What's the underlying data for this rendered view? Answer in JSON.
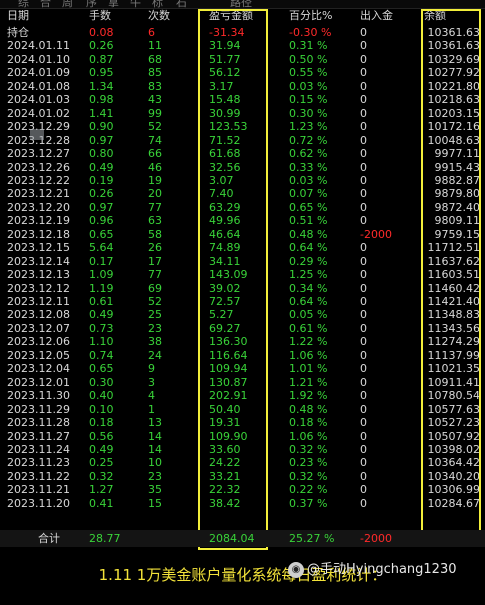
{
  "top_menu": [
    "综",
    "合",
    "周",
    "序",
    "拿",
    "牛",
    "标",
    "石",
    "路径"
  ],
  "headers": {
    "date": "日期",
    "qty": "手数",
    "count": "次数",
    "pnl": "盈亏金额",
    "pct": "百分比%",
    "io": "出入金",
    "balance": "余额"
  },
  "rows": [
    {
      "date": "持仓",
      "qty": "0.08",
      "count": "6",
      "pnl": "-31.34",
      "pct": "-0.30 %",
      "io": "0",
      "balance": "10361.63",
      "tone": "red"
    },
    {
      "date": "2024.01.11",
      "qty": "0.26",
      "count": "11",
      "pnl": "31.94",
      "pct": "0.31 %",
      "io": "0",
      "balance": "10361.63",
      "tone": "green"
    },
    {
      "date": "2024.01.10",
      "qty": "0.87",
      "count": "68",
      "pnl": "51.77",
      "pct": "0.50 %",
      "io": "0",
      "balance": "10329.69",
      "tone": "green"
    },
    {
      "date": "2024.01.09",
      "qty": "0.95",
      "count": "85",
      "pnl": "56.12",
      "pct": "0.55 %",
      "io": "0",
      "balance": "10277.92",
      "tone": "green"
    },
    {
      "date": "2024.01.08",
      "qty": "1.34",
      "count": "83",
      "pnl": "3.17",
      "pct": "0.03 %",
      "io": "0",
      "balance": "10221.80",
      "tone": "green"
    },
    {
      "date": "2024.01.03",
      "qty": "0.98",
      "count": "43",
      "pnl": "15.48",
      "pct": "0.15 %",
      "io": "0",
      "balance": "10218.63",
      "tone": "green"
    },
    {
      "date": "2024.01.02",
      "qty": "1.41",
      "count": "99",
      "pnl": "30.99",
      "pct": "0.30 %",
      "io": "0",
      "balance": "10203.15",
      "tone": "green"
    },
    {
      "date": "2023.12.29",
      "qty": "0.90",
      "count": "52",
      "pnl": "123.53",
      "pct": "1.23 %",
      "io": "0",
      "balance": "10172.16",
      "tone": "green"
    },
    {
      "date": "2023.12.28",
      "qty": "0.97",
      "count": "74",
      "pnl": "71.52",
      "pct": "0.72 %",
      "io": "0",
      "balance": "10048.63",
      "tone": "green"
    },
    {
      "date": "2023.12.27",
      "qty": "0.80",
      "count": "66",
      "pnl": "61.68",
      "pct": "0.62 %",
      "io": "0",
      "balance": "9977.11",
      "tone": "green"
    },
    {
      "date": "2023.12.26",
      "qty": "0.49",
      "count": "46",
      "pnl": "32.56",
      "pct": "0.33 %",
      "io": "0",
      "balance": "9915.43",
      "tone": "green"
    },
    {
      "date": "2023.12.22",
      "qty": "0.19",
      "count": "19",
      "pnl": "3.07",
      "pct": "0.03 %",
      "io": "0",
      "balance": "9882.87",
      "tone": "green"
    },
    {
      "date": "2023.12.21",
      "qty": "0.26",
      "count": "20",
      "pnl": "7.40",
      "pct": "0.07 %",
      "io": "0",
      "balance": "9879.80",
      "tone": "green"
    },
    {
      "date": "2023.12.20",
      "qty": "0.97",
      "count": "77",
      "pnl": "63.29",
      "pct": "0.65 %",
      "io": "0",
      "balance": "9872.40",
      "tone": "green"
    },
    {
      "date": "2023.12.19",
      "qty": "0.96",
      "count": "63",
      "pnl": "49.96",
      "pct": "0.51 %",
      "io": "0",
      "balance": "9809.11",
      "tone": "green"
    },
    {
      "date": "2023.12.18",
      "qty": "0.65",
      "count": "58",
      "pnl": "46.64",
      "pct": "0.48 %",
      "io": "-2000",
      "balance": "9759.15",
      "tone": "green",
      "io_tone": "red"
    },
    {
      "date": "2023.12.15",
      "qty": "5.64",
      "count": "26",
      "pnl": "74.89",
      "pct": "0.64 %",
      "io": "0",
      "balance": "11712.51",
      "tone": "green"
    },
    {
      "date": "2023.12.14",
      "qty": "0.17",
      "count": "17",
      "pnl": "34.11",
      "pct": "0.29 %",
      "io": "0",
      "balance": "11637.62",
      "tone": "green"
    },
    {
      "date": "2023.12.13",
      "qty": "1.09",
      "count": "77",
      "pnl": "143.09",
      "pct": "1.25 %",
      "io": "0",
      "balance": "11603.51",
      "tone": "green"
    },
    {
      "date": "2023.12.12",
      "qty": "1.19",
      "count": "69",
      "pnl": "39.02",
      "pct": "0.34 %",
      "io": "0",
      "balance": "11460.42",
      "tone": "green"
    },
    {
      "date": "2023.12.11",
      "qty": "0.61",
      "count": "52",
      "pnl": "72.57",
      "pct": "0.64 %",
      "io": "0",
      "balance": "11421.40",
      "tone": "green"
    },
    {
      "date": "2023.12.08",
      "qty": "0.49",
      "count": "25",
      "pnl": "5.27",
      "pct": "0.05 %",
      "io": "0",
      "balance": "11348.83",
      "tone": "green"
    },
    {
      "date": "2023.12.07",
      "qty": "0.73",
      "count": "23",
      "pnl": "69.27",
      "pct": "0.61 %",
      "io": "0",
      "balance": "11343.56",
      "tone": "green"
    },
    {
      "date": "2023.12.06",
      "qty": "1.10",
      "count": "38",
      "pnl": "136.30",
      "pct": "1.22 %",
      "io": "0",
      "balance": "11274.29",
      "tone": "green"
    },
    {
      "date": "2023.12.05",
      "qty": "0.74",
      "count": "24",
      "pnl": "116.64",
      "pct": "1.06 %",
      "io": "0",
      "balance": "11137.99",
      "tone": "green"
    },
    {
      "date": "2023.12.04",
      "qty": "0.65",
      "count": "9",
      "pnl": "109.94",
      "pct": "1.01 %",
      "io": "0",
      "balance": "11021.35",
      "tone": "green"
    },
    {
      "date": "2023.12.01",
      "qty": "0.30",
      "count": "3",
      "pnl": "130.87",
      "pct": "1.21 %",
      "io": "0",
      "balance": "10911.41",
      "tone": "green"
    },
    {
      "date": "2023.11.30",
      "qty": "0.40",
      "count": "4",
      "pnl": "202.91",
      "pct": "1.92 %",
      "io": "0",
      "balance": "10780.54",
      "tone": "green"
    },
    {
      "date": "2023.11.29",
      "qty": "0.10",
      "count": "1",
      "pnl": "50.40",
      "pct": "0.48 %",
      "io": "0",
      "balance": "10577.63",
      "tone": "green"
    },
    {
      "date": "2023.11.28",
      "qty": "0.18",
      "count": "13",
      "pnl": "19.31",
      "pct": "0.18 %",
      "io": "0",
      "balance": "10527.23",
      "tone": "green"
    },
    {
      "date": "2023.11.27",
      "qty": "0.56",
      "count": "14",
      "pnl": "109.90",
      "pct": "1.06 %",
      "io": "0",
      "balance": "10507.92",
      "tone": "green"
    },
    {
      "date": "2023.11.24",
      "qty": "0.49",
      "count": "14",
      "pnl": "33.60",
      "pct": "0.32 %",
      "io": "0",
      "balance": "10398.02",
      "tone": "green"
    },
    {
      "date": "2023.11.23",
      "qty": "0.25",
      "count": "10",
      "pnl": "24.22",
      "pct": "0.23 %",
      "io": "0",
      "balance": "10364.42",
      "tone": "green"
    },
    {
      "date": "2023.11.22",
      "qty": "0.32",
      "count": "23",
      "pnl": "33.21",
      "pct": "0.32 %",
      "io": "0",
      "balance": "10340.20",
      "tone": "green"
    },
    {
      "date": "2023.11.21",
      "qty": "1.27",
      "count": "35",
      "pnl": "22.32",
      "pct": "0.22 %",
      "io": "0",
      "balance": "10306.99",
      "tone": "green"
    },
    {
      "date": "2023.11.20",
      "qty": "0.41",
      "count": "15",
      "pnl": "38.42",
      "pct": "0.37 %",
      "io": "0",
      "balance": "10284.67",
      "tone": "green"
    }
  ],
  "totals": {
    "label": "合计",
    "qty": "28.77",
    "pnl": "2084.04",
    "pct": "25.27 %",
    "io": "-2000"
  },
  "caption": "1.11 1万美金账户量化系统每日盈利统计：",
  "watermark": {
    "text": "@手动Hyingchang1230",
    "icon": "weibo-logo-icon"
  },
  "colors": {
    "background": "#000000",
    "profit": "#39d339",
    "loss": "#ff2a2a",
    "highlight_box": "#f2ee3a",
    "caption": "#f2e23a"
  }
}
